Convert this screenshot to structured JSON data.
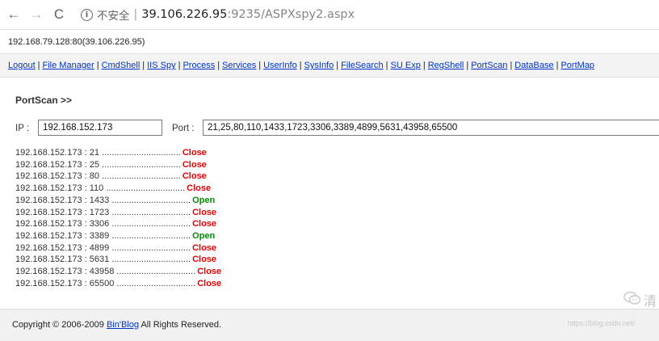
{
  "browser": {
    "back_glyph": "←",
    "forward_glyph": "→",
    "reload_glyph": "C",
    "info_glyph": "i",
    "security_label": "不安全",
    "separator": "|",
    "url_host": "39.106.226.95",
    "url_port_path": ":9235/ASPXspy2.aspx"
  },
  "server_info": "192.168.79.128:80(39.106.226.95)",
  "menu": {
    "items": [
      "Logout",
      "File Manager",
      "CmdShell",
      "IIS Spy",
      "Process",
      "Services",
      "UserInfo",
      "SysInfo",
      "FileSearch",
      "SU Exp",
      "RegShell",
      "PortScan",
      "DataBase",
      "PortMap"
    ],
    "separator": "|"
  },
  "portscan": {
    "title": "PortScan >>",
    "ip_label": "IP :",
    "ip_value": "192.168.152.173",
    "port_label": "Port :",
    "port_value": "21,25,80,110,1433,1723,3306,3389,4899,5631,43958,65500",
    "results": [
      {
        "text": "192.168.152.173 : 21 ................................",
        "status": "Close"
      },
      {
        "text": "192.168.152.173 : 25 ................................",
        "status": "Close"
      },
      {
        "text": "192.168.152.173 : 80 ................................",
        "status": "Close"
      },
      {
        "text": "192.168.152.173 : 110 ................................",
        "status": "Close"
      },
      {
        "text": "192.168.152.173 : 1433 ................................",
        "status": "Open"
      },
      {
        "text": "192.168.152.173 : 1723 ................................",
        "status": "Close"
      },
      {
        "text": "192.168.152.173 : 3306 ................................",
        "status": "Close"
      },
      {
        "text": "192.168.152.173 : 3389 ................................",
        "status": "Open"
      },
      {
        "text": "192.168.152.173 : 4899 ................................",
        "status": "Close"
      },
      {
        "text": "192.168.152.173 : 5631 ................................",
        "status": "Close"
      },
      {
        "text": "192.168.152.173 : 43958 ................................",
        "status": "Close"
      },
      {
        "text": "192.168.152.173 : 65500 ................................",
        "status": "Close"
      }
    ]
  },
  "footer": {
    "prefix": "Copyright © 2006-2009",
    "link": "Bin'Blog",
    "suffix": "All Rights Reserved."
  },
  "watermark": {
    "icon": "wechat-icon",
    "char": "清",
    "url": "https://blog.csdn.net/"
  },
  "colors": {
    "close": "#e60000",
    "open": "#0a8a0a",
    "link": "#0033cc"
  }
}
